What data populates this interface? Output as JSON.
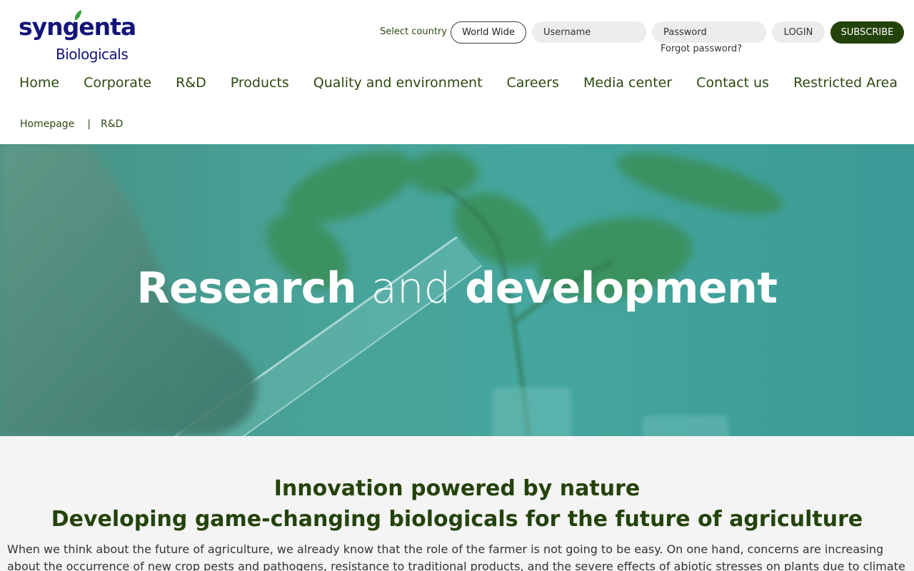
{
  "brand": {
    "name": "syngenta",
    "subname": "Biologicals",
    "colors": {
      "primary": "#14147a",
      "accent": "#24430b",
      "leaf": "#3aa33a"
    }
  },
  "top": {
    "select_country_label": "Select country",
    "country_value": "World Wide",
    "username_placeholder": "Username",
    "password_placeholder": "Password",
    "login_label": "LOGIN",
    "subscribe_label": "SUBSCRIBE",
    "forgot_label": "Forgot password?"
  },
  "nav": {
    "items": [
      {
        "label": "Home"
      },
      {
        "label": "Corporate"
      },
      {
        "label": "R&D"
      },
      {
        "label": "Products"
      },
      {
        "label": "Quality and environment"
      },
      {
        "label": "Careers"
      },
      {
        "label": "Media center"
      },
      {
        "label": "Contact us"
      },
      {
        "label": "Restricted Area"
      }
    ]
  },
  "breadcrumb": {
    "home": "Homepage",
    "separator": "|",
    "current": "R&D"
  },
  "hero": {
    "title_a": "Research",
    "title_b": "and",
    "title_c": "development"
  },
  "content": {
    "heading1": "Innovation powered by nature",
    "heading2": "Developing game-changing biologicals for the future of agriculture",
    "paragraph": "When we think about the future of agriculture, we already know that the role of the farmer is not going to be easy. On one hand, concerns are increasing about the occurrence of new crop pests and pathogens, resistance to traditional products, and the severe effects of abiotic stresses on plants due to climate change. On the other,"
  }
}
